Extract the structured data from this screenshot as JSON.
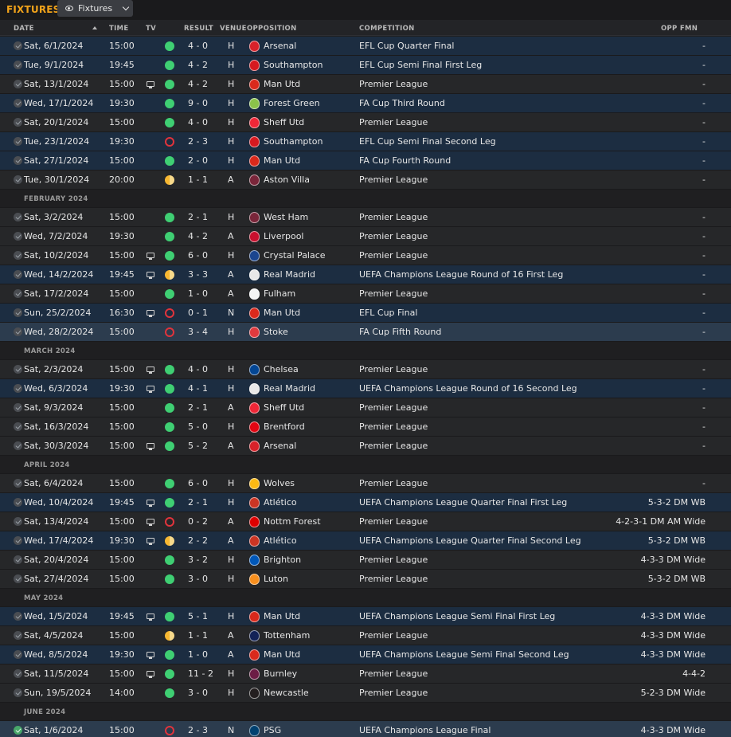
{
  "title": "FIXTURES",
  "view_button": {
    "label": "Fixtures",
    "icon": "eye-icon"
  },
  "columns": {
    "date": "DATE",
    "time": "TIME",
    "tv": "TV",
    "result": "RESULT",
    "venue": "VENUE",
    "opposition": "OPPOSITION",
    "competition": "COMPETITION",
    "opp_fmn": "OPP FMN"
  },
  "colors": {
    "accent": "#f2a31a",
    "win": "#3fcf73",
    "loss": "#e0343c",
    "draw": "#f7b731",
    "row_highlight": "#1c2d41"
  },
  "rows": [
    {
      "type": "match",
      "date": "Sat, 6/1/2024",
      "time": "15:00",
      "tv": false,
      "outcome": "W",
      "result": "4 - 0",
      "venue": "H",
      "opposition": "Arsenal",
      "badge": "#d8222a",
      "competition": "EFL Cup Quarter Final",
      "fmn": "-",
      "hl": true,
      "done": false
    },
    {
      "type": "match",
      "date": "Tue, 9/1/2024",
      "time": "19:45",
      "tv": false,
      "outcome": "W",
      "result": "4 - 2",
      "venue": "H",
      "opposition": "Southampton",
      "badge": "#d71920",
      "competition": "EFL Cup Semi Final First Leg",
      "fmn": "-",
      "hl": true,
      "done": false
    },
    {
      "type": "match",
      "date": "Sat, 13/1/2024",
      "time": "15:00",
      "tv": true,
      "outcome": "W",
      "result": "4 - 2",
      "venue": "H",
      "opposition": "Man Utd",
      "badge": "#da291c",
      "competition": "Premier League",
      "fmn": "-",
      "hl": false,
      "done": false
    },
    {
      "type": "match",
      "date": "Wed, 17/1/2024",
      "time": "19:30",
      "tv": false,
      "outcome": "W",
      "result": "9 - 0",
      "venue": "H",
      "opposition": "Forest Green",
      "badge": "#8bc34a",
      "competition": "FA Cup Third Round",
      "fmn": "-",
      "hl": true,
      "done": false
    },
    {
      "type": "match",
      "date": "Sat, 20/1/2024",
      "time": "15:00",
      "tv": false,
      "outcome": "W",
      "result": "4 - 0",
      "venue": "H",
      "opposition": "Sheff Utd",
      "badge": "#ee2737",
      "competition": "Premier League",
      "fmn": "-",
      "hl": false,
      "done": false
    },
    {
      "type": "match",
      "date": "Tue, 23/1/2024",
      "time": "19:30",
      "tv": false,
      "outcome": "L",
      "result": "2 - 3",
      "venue": "H",
      "opposition": "Southampton",
      "badge": "#d71920",
      "competition": "EFL Cup Semi Final Second Leg",
      "fmn": "-",
      "hl": true,
      "done": false
    },
    {
      "type": "match",
      "date": "Sat, 27/1/2024",
      "time": "15:00",
      "tv": false,
      "outcome": "W",
      "result": "2 - 0",
      "venue": "H",
      "opposition": "Man Utd",
      "badge": "#da291c",
      "competition": "FA Cup Fourth Round",
      "fmn": "-",
      "hl": true,
      "done": false
    },
    {
      "type": "match",
      "date": "Tue, 30/1/2024",
      "time": "20:00",
      "tv": false,
      "outcome": "D",
      "result": "1 - 1",
      "venue": "A",
      "opposition": "Aston Villa",
      "badge": "#7a263a",
      "competition": "Premier League",
      "fmn": "-",
      "hl": false,
      "done": false
    },
    {
      "type": "month",
      "label": "FEBRUARY 2024"
    },
    {
      "type": "match",
      "date": "Sat, 3/2/2024",
      "time": "15:00",
      "tv": false,
      "outcome": "W",
      "result": "2 - 1",
      "venue": "H",
      "opposition": "West Ham",
      "badge": "#7a263a",
      "competition": "Premier League",
      "fmn": "-",
      "hl": false,
      "done": false
    },
    {
      "type": "match",
      "date": "Wed, 7/2/2024",
      "time": "19:30",
      "tv": false,
      "outcome": "W",
      "result": "4 - 2",
      "venue": "A",
      "opposition": "Liverpool",
      "badge": "#c8102e",
      "competition": "Premier League",
      "fmn": "-",
      "hl": false,
      "done": false
    },
    {
      "type": "match",
      "date": "Sat, 10/2/2024",
      "time": "15:00",
      "tv": true,
      "outcome": "W",
      "result": "6 - 0",
      "venue": "H",
      "opposition": "Crystal Palace",
      "badge": "#1b458f",
      "competition": "Premier League",
      "fmn": "-",
      "hl": false,
      "done": false
    },
    {
      "type": "match",
      "date": "Wed, 14/2/2024",
      "time": "19:45",
      "tv": true,
      "outcome": "D",
      "result": "3 - 3",
      "venue": "A",
      "opposition": "Real Madrid",
      "badge": "#e8e8e8",
      "competition": "UEFA Champions League Round of 16 First Leg",
      "fmn": "-",
      "hl": true,
      "done": false
    },
    {
      "type": "match",
      "date": "Sat, 17/2/2024",
      "time": "15:00",
      "tv": false,
      "outcome": "W",
      "result": "1 - 0",
      "venue": "A",
      "opposition": "Fulham",
      "badge": "#f4f4f4",
      "competition": "Premier League",
      "fmn": "-",
      "hl": false,
      "done": false
    },
    {
      "type": "match",
      "date": "Sun, 25/2/2024",
      "time": "16:30",
      "tv": true,
      "outcome": "L",
      "result": "0 - 1",
      "venue": "N",
      "opposition": "Man Utd",
      "badge": "#da291c",
      "competition": "EFL Cup Final",
      "fmn": "-",
      "hl": true,
      "done": false
    },
    {
      "type": "match",
      "date": "Wed, 28/2/2024",
      "time": "15:00",
      "tv": false,
      "outcome": "L",
      "result": "3 - 4",
      "venue": "H",
      "opposition": "Stoke",
      "badge": "#e03a3e",
      "competition": "FA Cup Fifth Round",
      "fmn": "-",
      "hl": true,
      "done": false,
      "last": true
    },
    {
      "type": "month",
      "label": "MARCH 2024"
    },
    {
      "type": "match",
      "date": "Sat, 2/3/2024",
      "time": "15:00",
      "tv": true,
      "outcome": "W",
      "result": "4 - 0",
      "venue": "H",
      "opposition": "Chelsea",
      "badge": "#034694",
      "competition": "Premier League",
      "fmn": "-",
      "hl": false,
      "done": false
    },
    {
      "type": "match",
      "date": "Wed, 6/3/2024",
      "time": "19:30",
      "tv": true,
      "outcome": "W",
      "result": "4 - 1",
      "venue": "H",
      "opposition": "Real Madrid",
      "badge": "#e8e8e8",
      "competition": "UEFA Champions League Round of 16 Second Leg",
      "fmn": "-",
      "hl": true,
      "done": false
    },
    {
      "type": "match",
      "date": "Sat, 9/3/2024",
      "time": "15:00",
      "tv": false,
      "outcome": "W",
      "result": "2 - 1",
      "venue": "A",
      "opposition": "Sheff Utd",
      "badge": "#ee2737",
      "competition": "Premier League",
      "fmn": "-",
      "hl": false,
      "done": false
    },
    {
      "type": "match",
      "date": "Sat, 16/3/2024",
      "time": "15:00",
      "tv": false,
      "outcome": "W",
      "result": "5 - 0",
      "venue": "H",
      "opposition": "Brentford",
      "badge": "#e30613",
      "competition": "Premier League",
      "fmn": "-",
      "hl": false,
      "done": false
    },
    {
      "type": "match",
      "date": "Sat, 30/3/2024",
      "time": "15:00",
      "tv": true,
      "outcome": "W",
      "result": "5 - 2",
      "venue": "A",
      "opposition": "Arsenal",
      "badge": "#d8222a",
      "competition": "Premier League",
      "fmn": "-",
      "hl": false,
      "done": false
    },
    {
      "type": "month",
      "label": "APRIL 2024"
    },
    {
      "type": "match",
      "date": "Sat, 6/4/2024",
      "time": "15:00",
      "tv": false,
      "outcome": "W",
      "result": "6 - 0",
      "venue": "H",
      "opposition": "Wolves",
      "badge": "#fdb913",
      "competition": "Premier League",
      "fmn": "-",
      "hl": false,
      "done": false
    },
    {
      "type": "match",
      "date": "Wed, 10/4/2024",
      "time": "19:45",
      "tv": true,
      "outcome": "W",
      "result": "2 - 1",
      "venue": "H",
      "opposition": "Atlético",
      "badge": "#cb3524",
      "competition": "UEFA Champions League Quarter Final First Leg",
      "fmn": "5-3-2 DM WB",
      "hl": true,
      "done": false
    },
    {
      "type": "match",
      "date": "Sat, 13/4/2024",
      "time": "15:00",
      "tv": true,
      "outcome": "L",
      "result": "0 - 2",
      "venue": "A",
      "opposition": "Nottm Forest",
      "badge": "#dd0000",
      "competition": "Premier League",
      "fmn": "4-2-3-1 DM AM Wide",
      "hl": false,
      "done": false
    },
    {
      "type": "match",
      "date": "Wed, 17/4/2024",
      "time": "19:30",
      "tv": true,
      "outcome": "D",
      "result": "2 - 2",
      "venue": "A",
      "opposition": "Atlético",
      "badge": "#cb3524",
      "competition": "UEFA Champions League Quarter Final Second Leg",
      "fmn": "5-3-2 DM WB",
      "hl": true,
      "done": false
    },
    {
      "type": "match",
      "date": "Sat, 20/4/2024",
      "time": "15:00",
      "tv": false,
      "outcome": "W",
      "result": "3 - 2",
      "venue": "H",
      "opposition": "Brighton",
      "badge": "#0057b8",
      "competition": "Premier League",
      "fmn": "4-3-3 DM Wide",
      "hl": false,
      "done": false
    },
    {
      "type": "match",
      "date": "Sat, 27/4/2024",
      "time": "15:00",
      "tv": false,
      "outcome": "W",
      "result": "3 - 0",
      "venue": "H",
      "opposition": "Luton",
      "badge": "#f78f1e",
      "competition": "Premier League",
      "fmn": "5-3-2 DM WB",
      "hl": false,
      "done": false
    },
    {
      "type": "month",
      "label": "MAY 2024"
    },
    {
      "type": "match",
      "date": "Wed, 1/5/2024",
      "time": "19:45",
      "tv": true,
      "outcome": "W",
      "result": "5 - 1",
      "venue": "H",
      "opposition": "Man Utd",
      "badge": "#da291c",
      "competition": "UEFA Champions League Semi Final First Leg",
      "fmn": "4-3-3 DM Wide",
      "hl": true,
      "done": false
    },
    {
      "type": "match",
      "date": "Sat, 4/5/2024",
      "time": "15:00",
      "tv": false,
      "outcome": "D",
      "result": "1 - 1",
      "venue": "A",
      "opposition": "Tottenham",
      "badge": "#132257",
      "competition": "Premier League",
      "fmn": "4-3-3 DM Wide",
      "hl": false,
      "done": false
    },
    {
      "type": "match",
      "date": "Wed, 8/5/2024",
      "time": "19:30",
      "tv": true,
      "outcome": "W",
      "result": "1 - 0",
      "venue": "A",
      "opposition": "Man Utd",
      "badge": "#da291c",
      "competition": "UEFA Champions League Semi Final Second Leg",
      "fmn": "4-3-3 DM Wide",
      "hl": true,
      "done": false
    },
    {
      "type": "match",
      "date": "Sat, 11/5/2024",
      "time": "15:00",
      "tv": true,
      "outcome": "W",
      "result": "11 - 2",
      "venue": "H",
      "opposition": "Burnley",
      "badge": "#6c1d45",
      "competition": "Premier League",
      "fmn": "4-4-2",
      "hl": false,
      "done": false
    },
    {
      "type": "match",
      "date": "Sun, 19/5/2024",
      "time": "14:00",
      "tv": false,
      "outcome": "W",
      "result": "3 - 0",
      "venue": "H",
      "opposition": "Newcastle",
      "badge": "#241f20",
      "competition": "Premier League",
      "fmn": "5-2-3 DM Wide",
      "hl": false,
      "done": false
    },
    {
      "type": "month",
      "label": "JUNE 2024"
    },
    {
      "type": "match",
      "date": "Sat, 1/6/2024",
      "time": "15:00",
      "tv": false,
      "outcome": "L",
      "result": "2 - 3",
      "venue": "N",
      "opposition": "PSG",
      "badge": "#004170",
      "competition": "UEFA Champions League Final",
      "fmn": "4-3-3 DM Wide",
      "hl": true,
      "done": true,
      "last": true
    }
  ]
}
